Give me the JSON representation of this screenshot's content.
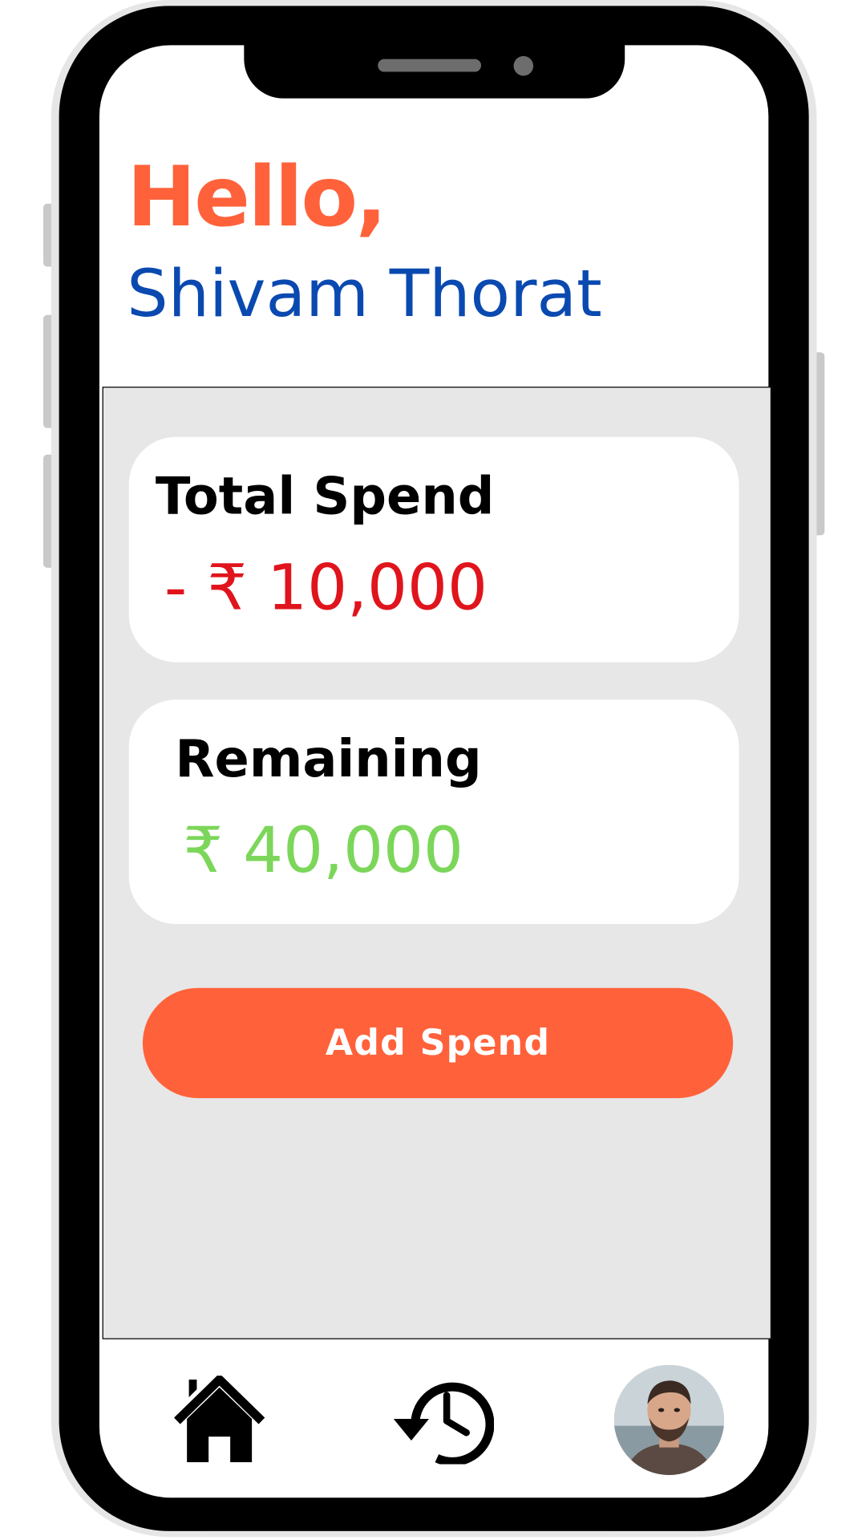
{
  "greeting": {
    "hello": "Hello,",
    "name": "Shivam Thorat"
  },
  "cards": {
    "total_spend": {
      "label": "Total Spend",
      "amount": "- ₹ 10,000",
      "color": "#e0141c"
    },
    "remaining": {
      "label": "Remaining",
      "amount": "₹ 40,000",
      "color": "#7cd65a"
    }
  },
  "actions": {
    "add_spend_label": "Add Spend"
  },
  "bottom_nav": {
    "items": [
      {
        "icon": "home-icon"
      },
      {
        "icon": "history-icon"
      },
      {
        "icon": "profile-avatar"
      }
    ]
  },
  "colors": {
    "accent": "#ff623b",
    "name_blue": "#0a49b0",
    "panel_bg": "#e7e7e7"
  }
}
